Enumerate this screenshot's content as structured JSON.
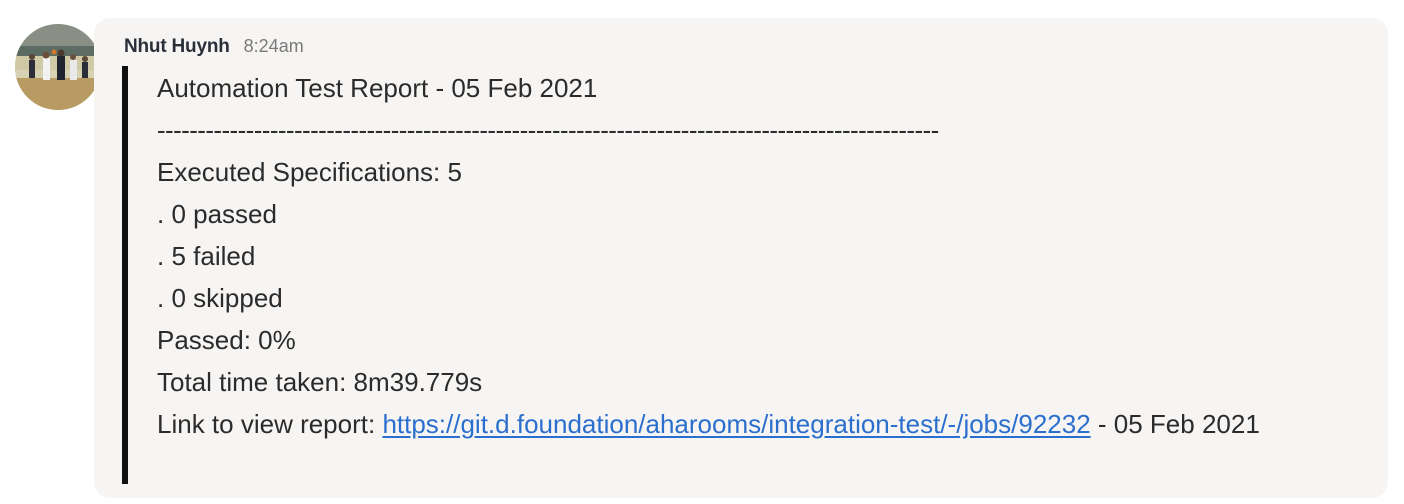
{
  "message": {
    "author": "Nhut Huynh",
    "timestamp": "8:24am",
    "avatar_icon": "basketball-photo-avatar",
    "lines": {
      "title": "Automation Test Report - 05 Feb 2021",
      "separator": "-------------------------------------------------------------------------------------------------",
      "executed": "Executed Specifications: 5",
      "passed": ". 0 passed",
      "failed": ". 5 failed",
      "skipped": ". 0 skipped",
      "passed_percent": "Passed: 0%",
      "total_time": "Total time taken: 8m39.779s",
      "link_prefix": "Link to view report: ",
      "link_text": "https://git.d.foundation/aharooms/integration-test/-/jobs/92232",
      "link_suffix": " - 05 Feb 2021"
    }
  },
  "colors": {
    "bubble_background": "#f7f5f3",
    "quote_bar": "#111111",
    "link": "#2a6fce",
    "author": "#2b2f3a",
    "timestamp": "#7a7a7a"
  }
}
